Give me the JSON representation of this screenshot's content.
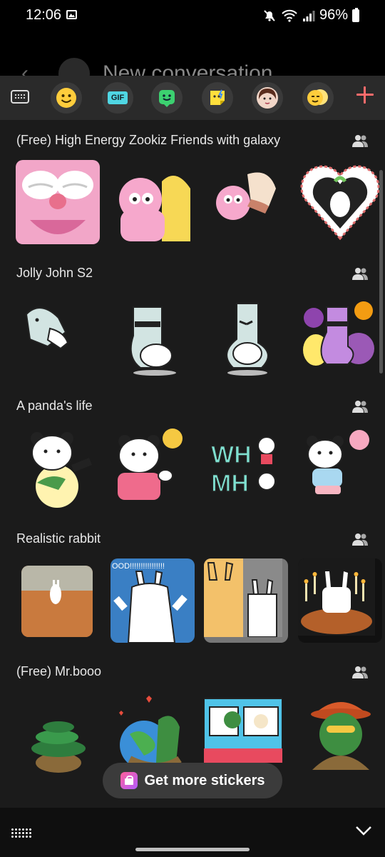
{
  "status_bar": {
    "time": "12:06",
    "battery": "96%",
    "icons": [
      "gallery-icon",
      "mute-icon",
      "wifi-icon",
      "signal-icon",
      "battery-icon"
    ]
  },
  "background_screen": {
    "title": "New conversation"
  },
  "tabs": [
    {
      "name": "keyboard-tab",
      "icon": "keyboard-icon"
    },
    {
      "name": "emoji-tab",
      "icon": "smiley-face-icon"
    },
    {
      "name": "gif-tab",
      "label": "GIF"
    },
    {
      "name": "bitmoji-tab",
      "icon": "bitmoji-icon"
    },
    {
      "name": "sticker-app-tab",
      "icon": "sticker-icon"
    },
    {
      "name": "avatar-tab",
      "icon": "avatar-icon"
    },
    {
      "name": "emoji-sticker-tab",
      "icon": "wink-face-icon"
    },
    {
      "name": "add-tab",
      "icon": "plus-icon"
    }
  ],
  "sections": [
    {
      "title": "(Free) High Energy Zookiz Friends with galaxy"
    },
    {
      "title": "Jolly John S2"
    },
    {
      "title": "A panda's life"
    },
    {
      "title": "Realistic rabbit"
    },
    {
      "title": "(Free) Mr.booo"
    }
  ],
  "sticker_texts": {
    "wh": "WH",
    "mh": "MH",
    "ood": "OOD!!!!!!!!!!!!!!!!"
  },
  "get_more": {
    "label": "Get more stickers"
  },
  "colors": {
    "panel_bg": "#1b1b1b",
    "tabbar_bg": "#2a2a2a",
    "accent_add": "#ff6b6b"
  }
}
